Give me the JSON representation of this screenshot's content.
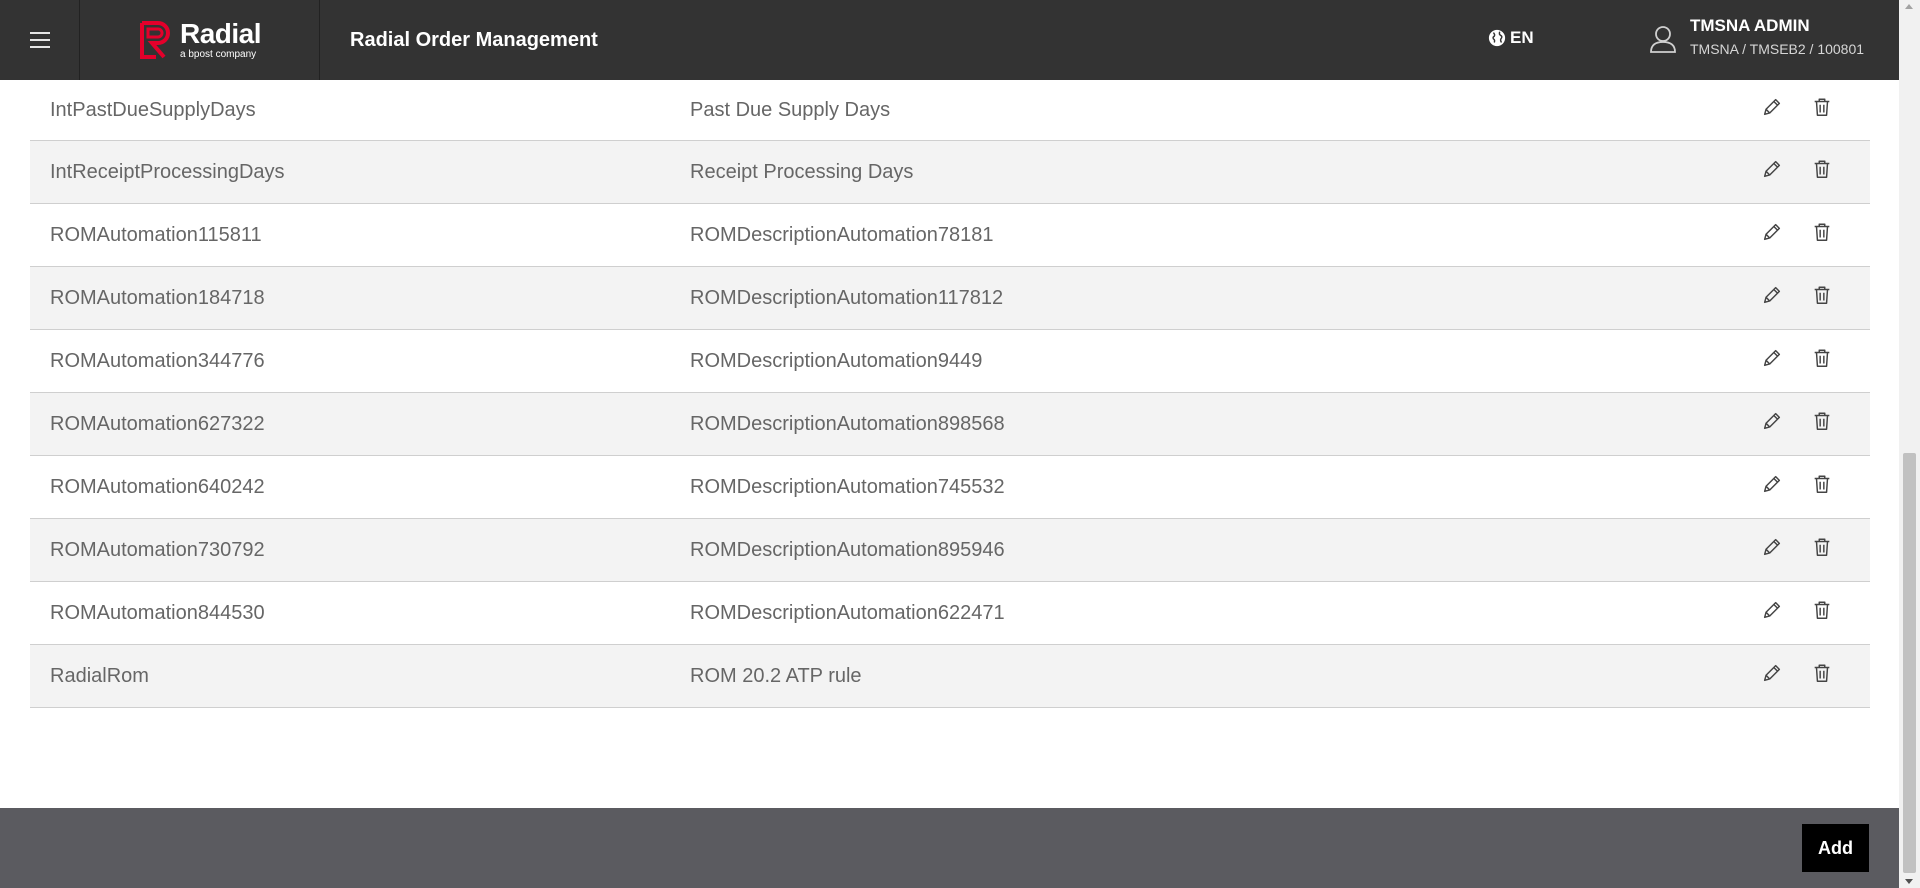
{
  "header": {
    "app_title": "Radial Order Management",
    "logo_name": "Radial",
    "logo_tagline": "a bpost company",
    "language": "EN",
    "user_name": "TMSNA ADMIN",
    "user_org": "TMSNA / TMSEB2 / 100801"
  },
  "rows": [
    {
      "name": "IntPastDueSupplyDays",
      "description": "Past Due Supply Days"
    },
    {
      "name": "IntReceiptProcessingDays",
      "description": "Receipt Processing Days"
    },
    {
      "name": "ROMAutomation115811",
      "description": "ROMDescriptionAutomation78181"
    },
    {
      "name": "ROMAutomation184718",
      "description": "ROMDescriptionAutomation117812"
    },
    {
      "name": "ROMAutomation344776",
      "description": "ROMDescriptionAutomation9449"
    },
    {
      "name": "ROMAutomation627322",
      "description": "ROMDescriptionAutomation898568"
    },
    {
      "name": "ROMAutomation640242",
      "description": "ROMDescriptionAutomation745532"
    },
    {
      "name": "ROMAutomation730792",
      "description": "ROMDescriptionAutomation895946"
    },
    {
      "name": "ROMAutomation844530",
      "description": "ROMDescriptionAutomation622471"
    },
    {
      "name": "RadialRom",
      "description": "ROM 20.2 ATP rule"
    }
  ],
  "footer": {
    "add_label": "Add"
  },
  "colors": {
    "header_bg": "#333333",
    "brand_red": "#e4002b",
    "footer_bg": "#5b5b60",
    "row_alt_bg": "#f3f3f3"
  },
  "icons": {
    "menu": "hamburger-icon",
    "language": "globe-icon",
    "user": "user-icon",
    "edit": "pencil-icon",
    "delete": "trash-icon"
  }
}
